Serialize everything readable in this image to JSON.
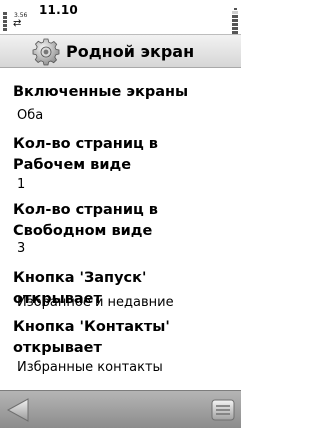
{
  "status": {
    "time": "11.10",
    "speed_value": "3.56",
    "arrows": "⇄"
  },
  "header": {
    "title": "Родной экран",
    "icon": "gear-icon"
  },
  "settings": [
    {
      "label": "Включенные экраны",
      "value": "Оба"
    },
    {
      "label": "Кол-во страниц в Рабочем виде",
      "value": "1"
    },
    {
      "label": "Кол-во страниц в Свободном виде",
      "value": "3"
    },
    {
      "label": "Кнопка 'Запуск' открывает",
      "value": "Избранное и недавние"
    },
    {
      "label": "Кнопка 'Контакты' открывает",
      "value": "Избранные контакты"
    }
  ],
  "softkeys": {
    "left_icon": "back-arrow-icon",
    "right_icon": "menu-icon"
  }
}
